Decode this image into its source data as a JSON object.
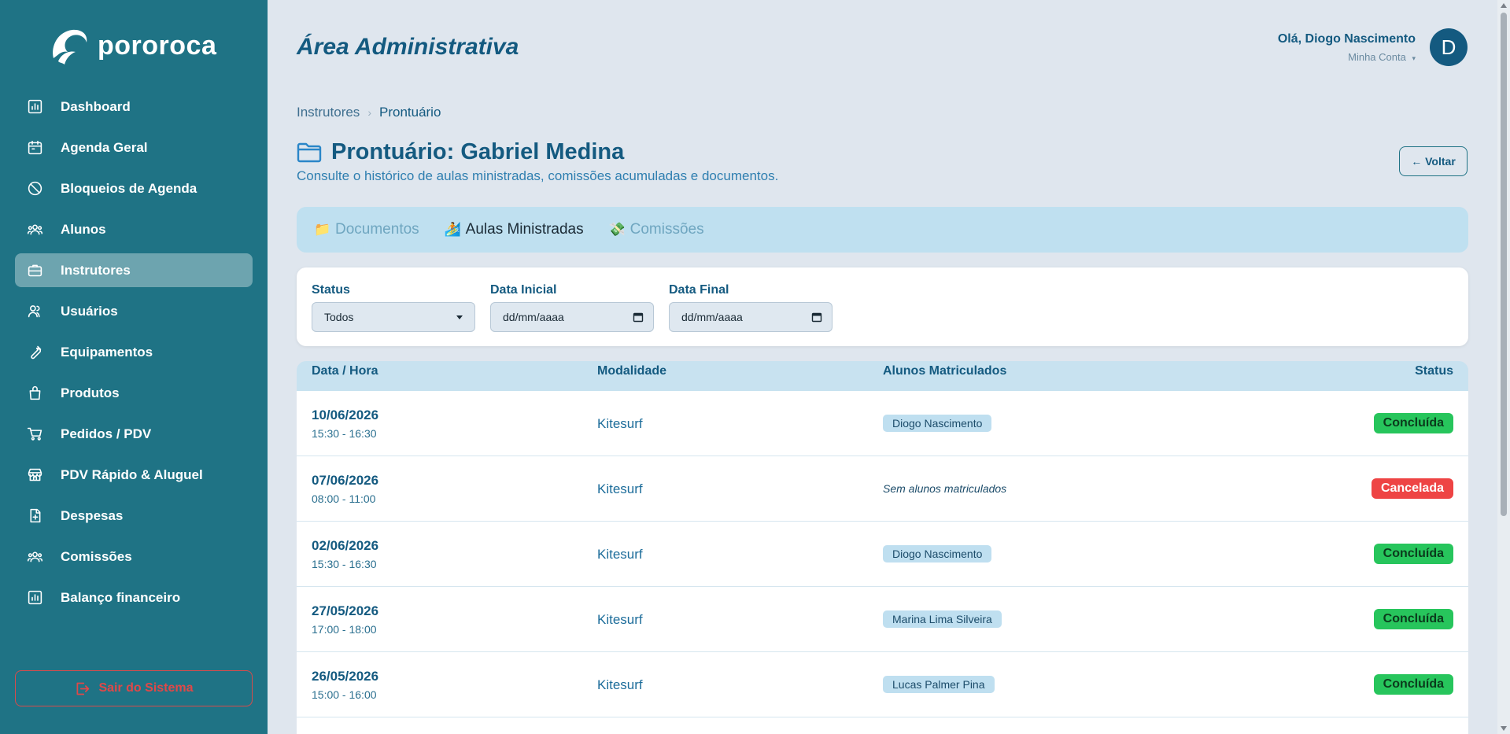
{
  "brand": {
    "name": "pororoca"
  },
  "sidebar": {
    "items": [
      {
        "label": "Dashboard",
        "icon": "chart-icon"
      },
      {
        "label": "Agenda Geral",
        "icon": "calendar-icon"
      },
      {
        "label": "Bloqueios de Agenda",
        "icon": "block-icon"
      },
      {
        "label": "Alunos",
        "icon": "users-icon"
      },
      {
        "label": "Instrutores",
        "icon": "briefcase-icon",
        "active": true
      },
      {
        "label": "Usuários",
        "icon": "user-group-icon"
      },
      {
        "label": "Equipamentos",
        "icon": "wrench-icon"
      },
      {
        "label": "Produtos",
        "icon": "bag-icon"
      },
      {
        "label": "Pedidos / PDV",
        "icon": "cart-icon"
      },
      {
        "label": "PDV Rápido & Aluguel",
        "icon": "store-icon"
      },
      {
        "label": "Despesas",
        "icon": "file-plus-icon"
      },
      {
        "label": "Comissões",
        "icon": "users-icon"
      },
      {
        "label": "Balanço financeiro",
        "icon": "chart-icon"
      }
    ],
    "logout_label": "Sair do Sistema"
  },
  "header": {
    "title": "Área Administrativa",
    "greeting": "Olá, Diogo Nascimento",
    "account": "Minha Conta",
    "account_caret": "▾",
    "avatar_initial": "D"
  },
  "breadcrumb": {
    "parent": "Instrutores",
    "separator": "›",
    "current": "Prontuário"
  },
  "page": {
    "title": "Prontuário: Gabriel Medina",
    "subtitle": "Consulte o histórico de aulas ministradas, comissões acumuladas e documentos.",
    "back_label": "← Voltar"
  },
  "tabs": [
    {
      "label": "Documentos",
      "icon": "📁",
      "active": false
    },
    {
      "label": "Aulas Ministradas",
      "icon": "🏄",
      "active": true
    },
    {
      "label": "Comissões",
      "icon": "💸",
      "active": false
    }
  ],
  "filters": {
    "status": {
      "label": "Status",
      "value": "Todos"
    },
    "start": {
      "label": "Data Inicial",
      "value": "dd/mm/aaaa"
    },
    "end": {
      "label": "Data Final",
      "value": "dd/mm/aaaa"
    }
  },
  "table": {
    "headers": {
      "date": "Data / Hora",
      "modality": "Modalidade",
      "students": "Alunos Matriculados",
      "status": "Status"
    },
    "rows": [
      {
        "date": "10/06/2026",
        "time": "15:30 - 16:30",
        "modality": "Kitesurf",
        "students": "Diogo Nascimento",
        "status": "Concluída",
        "status_type": "done"
      },
      {
        "date": "07/06/2026",
        "time": "08:00 - 11:00",
        "modality": "Kitesurf",
        "students": "Sem alunos matriculados",
        "status": "Cancelada",
        "status_type": "cancel",
        "empty": true
      },
      {
        "date": "02/06/2026",
        "time": "15:30 - 16:30",
        "modality": "Kitesurf",
        "students": "Diogo Nascimento",
        "status": "Concluída",
        "status_type": "done"
      },
      {
        "date": "27/05/2026",
        "time": "17:00 - 18:00",
        "modality": "Kitesurf",
        "students": "Marina Lima Silveira",
        "status": "Concluída",
        "status_type": "done"
      },
      {
        "date": "26/05/2026",
        "time": "15:00 - 16:00",
        "modality": "Kitesurf",
        "students": "Lucas Palmer Pina",
        "status": "Concluída",
        "status_type": "done"
      }
    ]
  },
  "colors": {
    "sidebar": "#1f7385",
    "primary": "#145a80",
    "background": "#dfe6ee",
    "success": "#27c55c",
    "danger": "#ee4444"
  }
}
